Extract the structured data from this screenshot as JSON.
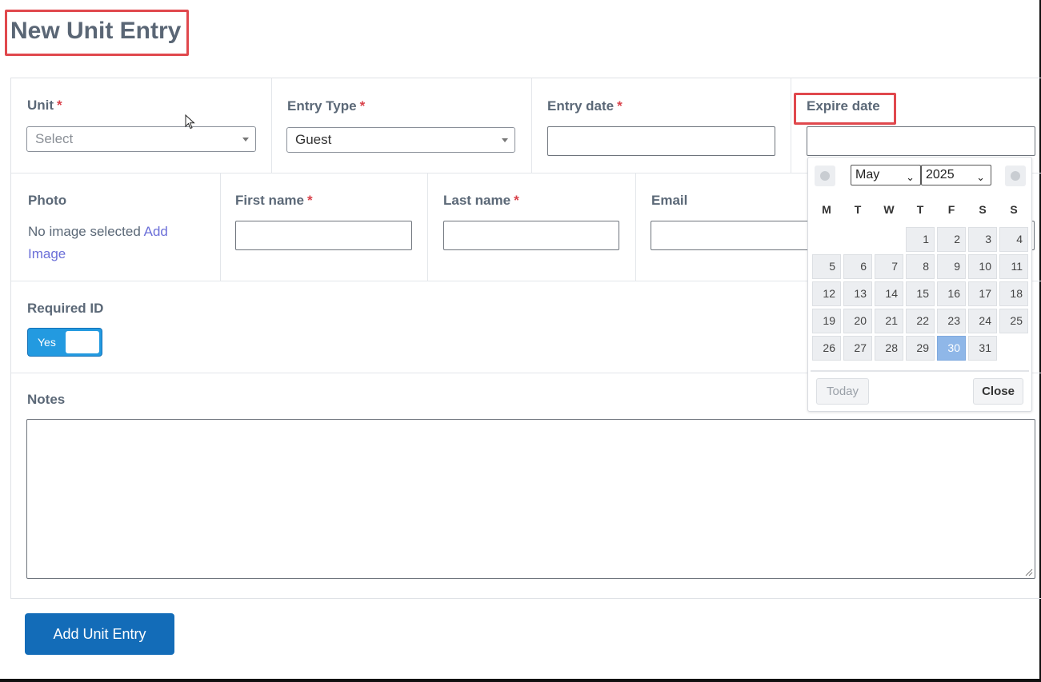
{
  "page": {
    "title": "New Unit Entry"
  },
  "form": {
    "unit": {
      "label": "Unit",
      "required_mark": "*",
      "value": "Select"
    },
    "entry_type": {
      "label": "Entry Type",
      "required_mark": "*",
      "value": "Guest"
    },
    "entry_date": {
      "label": "Entry date",
      "required_mark": "*",
      "value": ""
    },
    "expire_date": {
      "label": "Expire date",
      "value": ""
    },
    "photo": {
      "label": "Photo",
      "status_text": "No image selected",
      "add_link_line1": "Add",
      "add_link_line2": "Image"
    },
    "first_name": {
      "label": "First name",
      "required_mark": "*",
      "value": ""
    },
    "last_name": {
      "label": "Last name",
      "required_mark": "*",
      "value": ""
    },
    "email": {
      "label": "Email",
      "value": ""
    },
    "required_id": {
      "label": "Required ID",
      "toggle_label": "Yes",
      "on": true
    },
    "notes": {
      "label": "Notes",
      "value": ""
    },
    "submit_label": "Add Unit Entry"
  },
  "datepicker": {
    "month": "May",
    "year": "2025",
    "weekdays": [
      "M",
      "T",
      "W",
      "T",
      "F",
      "S",
      "S"
    ],
    "first_weekday_col": 3,
    "days": [
      "1",
      "2",
      "3",
      "4",
      "5",
      "6",
      "7",
      "8",
      "9",
      "10",
      "11",
      "12",
      "13",
      "14",
      "15",
      "16",
      "17",
      "18",
      "19",
      "20",
      "21",
      "22",
      "23",
      "24",
      "25",
      "26",
      "27",
      "28",
      "29",
      "30",
      "31"
    ],
    "selected_day": "30",
    "today_label": "Today",
    "close_label": "Close"
  },
  "colors": {
    "accent": "#239ae0",
    "primary_button": "#136cb8",
    "required": "#d9414a",
    "highlight": "#e0484d",
    "link": "#6b6fd8",
    "selected_day": "#8fb7e8"
  }
}
